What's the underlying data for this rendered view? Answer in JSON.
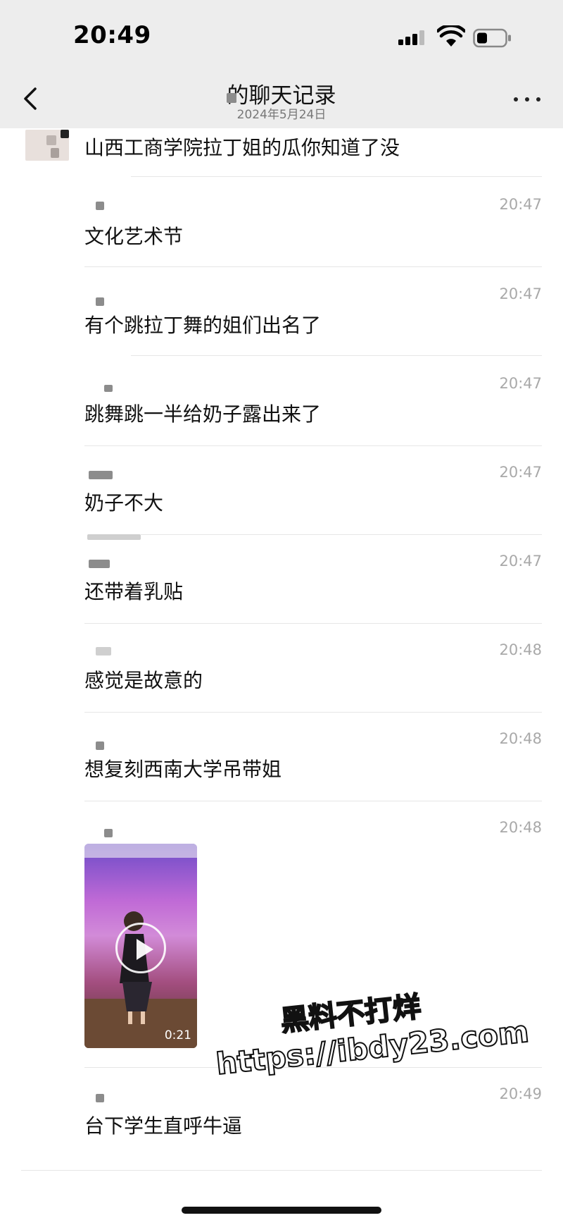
{
  "status_bar": {
    "time": "20:49"
  },
  "nav": {
    "title": "的聊天记录",
    "subtitle": "2024年5月24日"
  },
  "messages": [
    {
      "text": "山西工商学院拉丁姐的瓜你知道了没"
    },
    {
      "time": "20:47",
      "text": "文化艺术节"
    },
    {
      "time": "20:47",
      "text": "有个跳拉丁舞的姐们出名了"
    },
    {
      "time": "20:47",
      "text": "跳舞跳一半给奶子露出来了"
    },
    {
      "time": "20:47",
      "text": "奶子不大"
    },
    {
      "time": "20:47",
      "text": "还带着乳贴"
    },
    {
      "time": "20:48",
      "text": "感觉是故意的"
    },
    {
      "time": "20:48",
      "text": "想复刻西南大学吊带姐"
    },
    {
      "time": "20:48",
      "video_duration": "0:21"
    },
    {
      "time": "20:49",
      "text": "台下学生直呼牛逼"
    }
  ],
  "watermark": {
    "line1": "黑料不打烊",
    "line2": "https://ibdy23.com"
  },
  "icons": [
    "back-chevron-icon",
    "more-dots-icon",
    "signal-icon",
    "wifi-icon",
    "battery-icon",
    "play-icon"
  ],
  "colors": {
    "topbar": "#ededed",
    "timestamp": "#a9a9a9",
    "divider": "#e6e6e6"
  }
}
